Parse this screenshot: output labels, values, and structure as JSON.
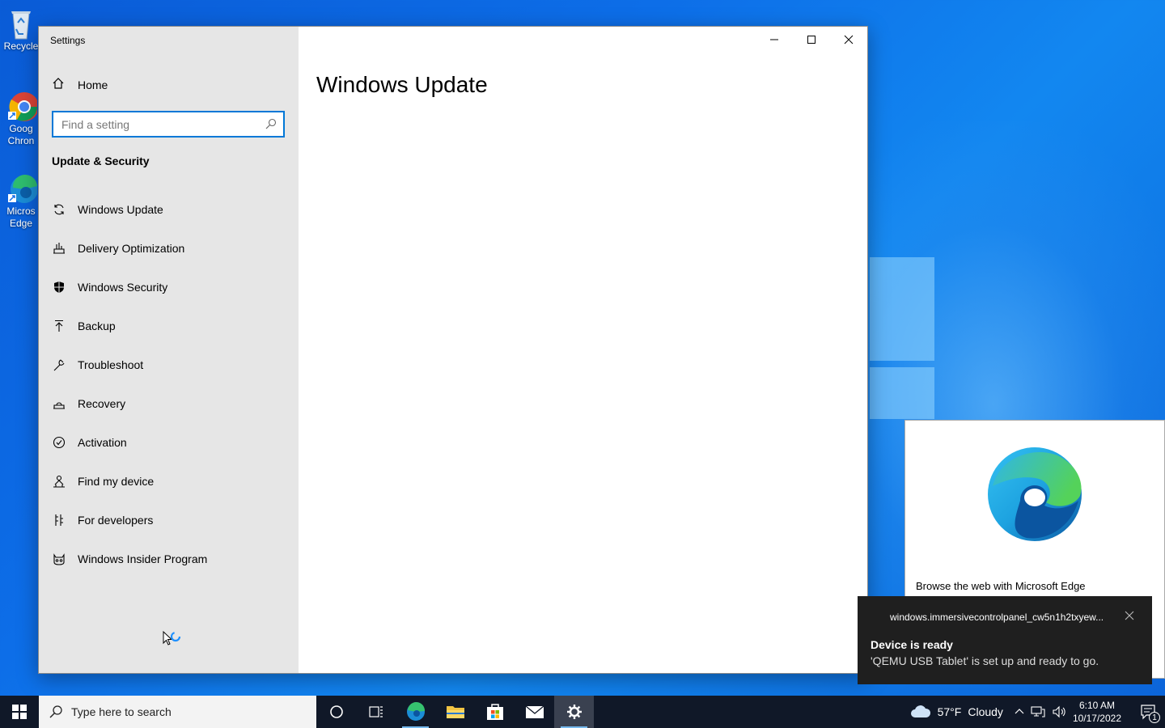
{
  "desktop": {
    "icons": [
      {
        "label": "Recycle"
      },
      {
        "label": "Goog Chron"
      },
      {
        "label": "Micros Edge"
      }
    ]
  },
  "settings_window": {
    "title": "Settings",
    "home_label": "Home",
    "search_placeholder": "Find a setting",
    "section_title": "Update & Security",
    "nav_items": [
      {
        "label": "Windows Update",
        "icon": "sync-icon"
      },
      {
        "label": "Delivery Optimization",
        "icon": "delivery-icon"
      },
      {
        "label": "Windows Security",
        "icon": "shield-icon"
      },
      {
        "label": "Backup",
        "icon": "backup-arrow-icon"
      },
      {
        "label": "Troubleshoot",
        "icon": "wrench-icon"
      },
      {
        "label": "Recovery",
        "icon": "recovery-icon"
      },
      {
        "label": "Activation",
        "icon": "check-circle-icon"
      },
      {
        "label": "Find my device",
        "icon": "person-location-icon"
      },
      {
        "label": "For developers",
        "icon": "developer-tools-icon"
      },
      {
        "label": "Windows Insider Program",
        "icon": "insider-cat-icon"
      }
    ],
    "page_title": "Windows Update"
  },
  "edge_promo": {
    "text": "Browse the web with Microsoft Edge"
  },
  "toast": {
    "app": "windows.immersivecontrolpanel_cw5n1h2txyew...",
    "title": "Device is ready",
    "body": "'QEMU USB Tablet' is set up and ready to go."
  },
  "taskbar": {
    "search_placeholder": "Type here to search",
    "weather": {
      "temp": "57°F",
      "condition": "Cloudy"
    },
    "clock": {
      "time": "6:10 AM",
      "date": "10/17/2022"
    },
    "notification_count": "1"
  },
  "colors": {
    "accent": "#0078d7",
    "taskbar": "#101828",
    "sidebar": "#e6e6e6"
  }
}
